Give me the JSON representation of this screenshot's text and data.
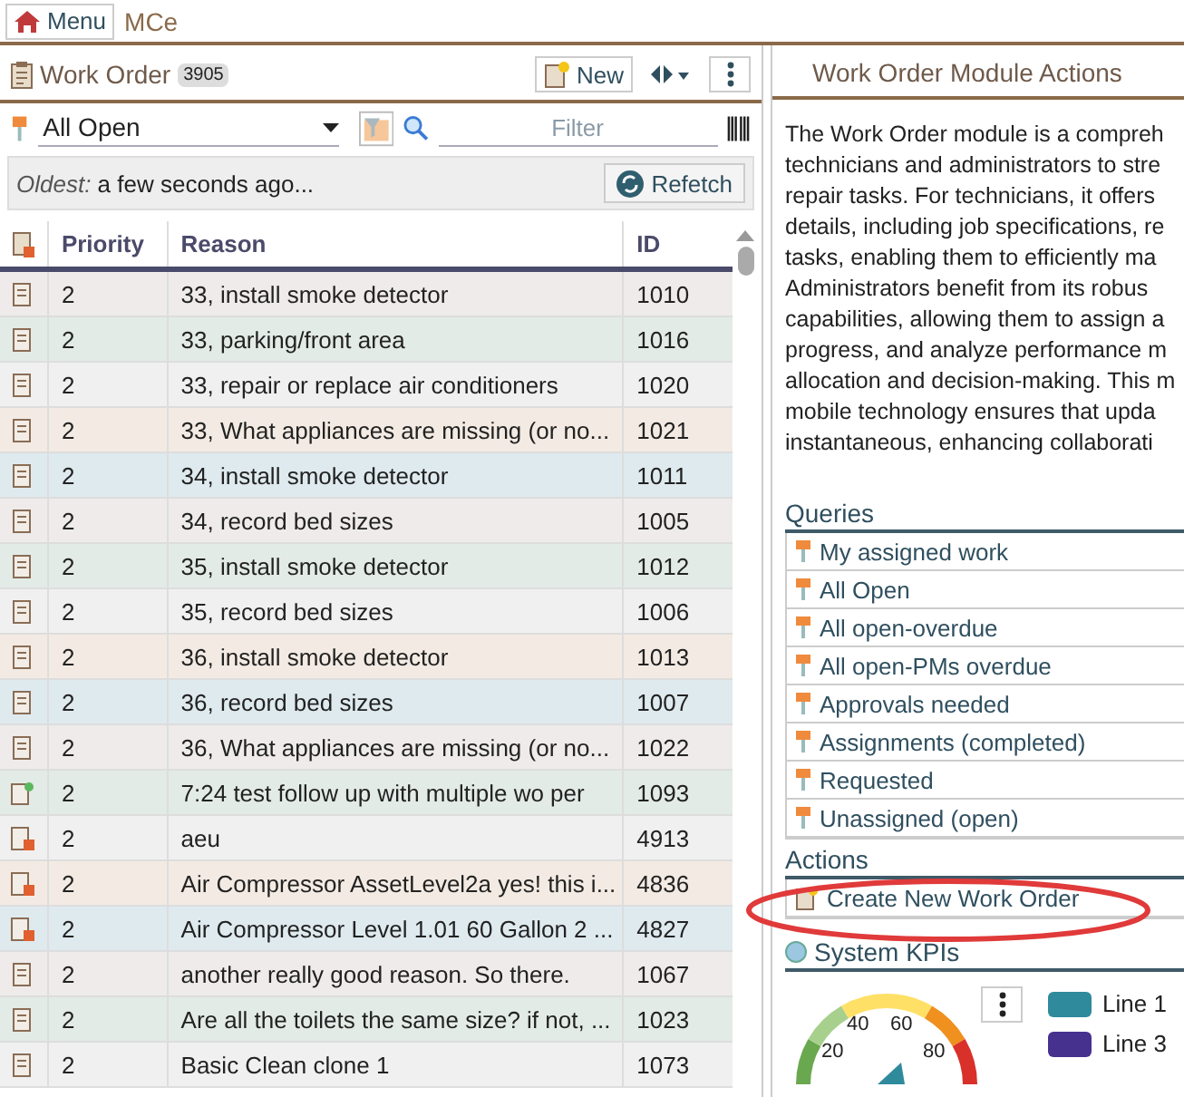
{
  "topbar": {
    "menu_label": "Menu",
    "app_name": "MCe"
  },
  "work_order": {
    "title": "Work Order",
    "count": "3905",
    "new_label": "New",
    "query": {
      "value": "All Open"
    },
    "filter": {
      "placeholder": "Filter"
    },
    "oldest_label": "Oldest:",
    "oldest_value": "a few seconds ago...",
    "refetch_label": "Refetch",
    "table": {
      "columns": [
        "Priority",
        "Reason",
        "ID"
      ],
      "rows": [
        {
          "kind": "plain",
          "color": "#efebeb",
          "priority": "2",
          "reason": "33, install smoke detector",
          "id": "1010"
        },
        {
          "kind": "plain",
          "color": "#e3ebe7",
          "priority": "2",
          "reason": "33, parking/front area",
          "id": "1016"
        },
        {
          "kind": "plain",
          "color": "#f0f0f0",
          "priority": "2",
          "reason": "33, repair or replace air conditioners",
          "id": "1020"
        },
        {
          "kind": "plain",
          "color": "#f3ebe3",
          "priority": "2",
          "reason": "33, What appliances are missing (or no...",
          "id": "1021"
        },
        {
          "kind": "plain",
          "color": "#dfeaef",
          "priority": "2",
          "reason": "34, install smoke detector",
          "id": "1011"
        },
        {
          "kind": "plain",
          "color": "#efebeb",
          "priority": "2",
          "reason": "34, record bed sizes",
          "id": "1005"
        },
        {
          "kind": "plain",
          "color": "#e3ebe7",
          "priority": "2",
          "reason": "35, install smoke detector",
          "id": "1012"
        },
        {
          "kind": "plain",
          "color": "#f0f0f0",
          "priority": "2",
          "reason": "35, record bed sizes",
          "id": "1006"
        },
        {
          "kind": "plain",
          "color": "#f3ebe3",
          "priority": "2",
          "reason": "36, install smoke detector",
          "id": "1013"
        },
        {
          "kind": "plain",
          "color": "#dfeaef",
          "priority": "2",
          "reason": "36, record bed sizes",
          "id": "1007"
        },
        {
          "kind": "plain",
          "color": "#efebeb",
          "priority": "2",
          "reason": "36, What appliances are missing (or no...",
          "id": "1022"
        },
        {
          "kind": "followup",
          "color": "#e3ebe7",
          "priority": "2",
          "reason": "7:24 test follow up with multiple wo per",
          "id": "1093"
        },
        {
          "kind": "alert",
          "color": "#f0f0f0",
          "priority": "2",
          "reason": "aeu",
          "id": "4913"
        },
        {
          "kind": "alert",
          "color": "#f3ebe3",
          "priority": "2",
          "reason": "Air Compressor AssetLevel2a yes! this i...",
          "id": "4836"
        },
        {
          "kind": "alert",
          "color": "#dfeaef",
          "priority": "2",
          "reason": "Air Compressor Level 1.01 60 Gallon 2 ...",
          "id": "4827"
        },
        {
          "kind": "plain",
          "color": "#efebeb",
          "priority": "2",
          "reason": "another really good reason. So there.",
          "id": "1067"
        },
        {
          "kind": "plain",
          "color": "#e3ebe7",
          "priority": "2",
          "reason": "Are all the toilets the same size? if not, ...",
          "id": "1023"
        },
        {
          "kind": "plain",
          "color": "#f0f0f0",
          "priority": "2",
          "reason": "Basic Clean clone 1",
          "id": "1073"
        }
      ]
    }
  },
  "module_actions": {
    "title": "Work Order Module Actions",
    "description_lines": [
      "The Work Order module is a compreh",
      "technicians and administrators to stre",
      "repair tasks. For technicians, it offers",
      "details, including job specifications, re",
      "tasks, enabling them to efficiently ma",
      "Administrators benefit from its robus",
      "capabilities, allowing them to assign a",
      "progress, and analyze performance m",
      "allocation and decision-making. This m",
      "mobile technology ensures that upda",
      "instantaneous, enhancing collaborati"
    ],
    "queries_heading": "Queries",
    "queries": [
      "My assigned work",
      "All Open",
      "All open-overdue",
      "All open-PMs overdue",
      "Approvals needed",
      "Assignments (completed)",
      "Requested",
      "Unassigned (open)"
    ],
    "actions_heading": "Actions",
    "actions": [
      "Create New Work Order"
    ],
    "kpis_heading": "System KPIs",
    "gauge_ticks": [
      "20",
      "40",
      "60",
      "80"
    ],
    "legend": [
      {
        "label": "Line 1",
        "color": "#2f8a9c"
      },
      {
        "label": "Line 3",
        "color": "#47318f"
      }
    ]
  }
}
